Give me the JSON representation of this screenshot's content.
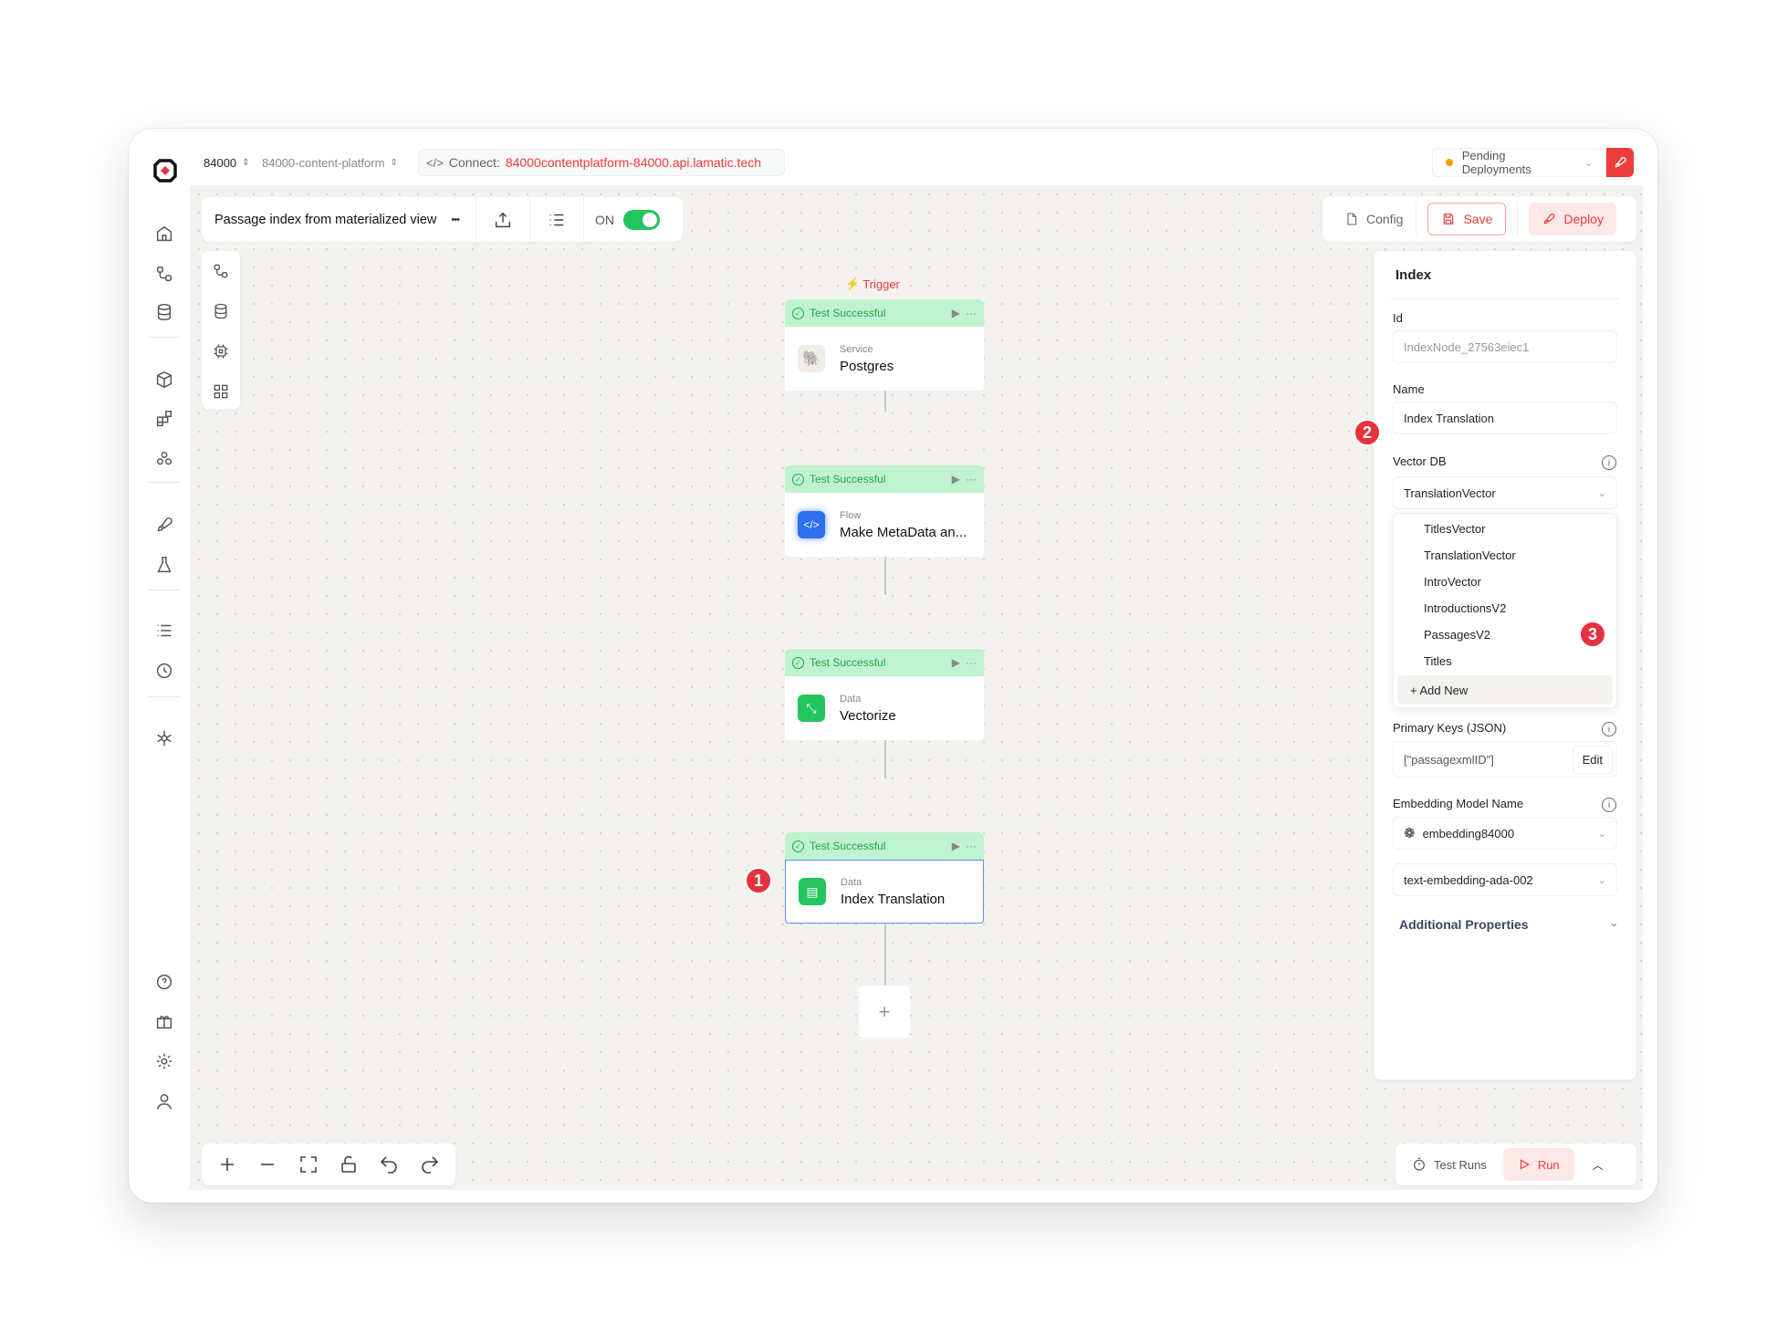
{
  "topbar": {
    "org": "84000",
    "project": "84000-content-platform",
    "connect_label": "Connect:",
    "connect_url": "84000contentplatform-84000.api.lamatic.tech",
    "pending": "Pending Deployments"
  },
  "toolbar": {
    "flow_name": "Passage index from materialized view",
    "more": "•••",
    "toggle_label": "ON",
    "toggle_on": true,
    "config": "Config",
    "save": "Save",
    "deploy": "Deploy"
  },
  "flow": {
    "trigger_label": "Trigger",
    "nodes": [
      {
        "status": "Test Successful",
        "category": "Service",
        "name": "Postgres",
        "icon": "postgres-icon"
      },
      {
        "status": "Test Successful",
        "category": "Flow",
        "name": "Make MetaData an...",
        "icon": "code-icon"
      },
      {
        "status": "Test Successful",
        "category": "Data",
        "name": "Vectorize",
        "icon": "vectorize-icon"
      },
      {
        "status": "Test Successful",
        "category": "Data",
        "name": "Index Translation",
        "icon": "index-icon"
      }
    ],
    "add": "+"
  },
  "annotations": [
    "1",
    "2",
    "3"
  ],
  "panel": {
    "title": "Index",
    "id_label": "Id",
    "id_value": "IndexNode_27563eiec1",
    "name_label": "Name",
    "name_value": "Index Translation",
    "vectordb_label": "Vector DB",
    "vectordb_value": "TranslationVector",
    "vectordb_options": [
      "TitlesVector",
      "TranslationVector",
      "IntroVector",
      "IntroductionsV2",
      "PassagesV2",
      "Titles"
    ],
    "add_new": "+ Add New",
    "pk_label": "Primary Keys (JSON)",
    "pk_value": "[\"passagexmlID\"]",
    "edit": "Edit",
    "emb_label": "Embedding Model Name",
    "emb_credential": "embedding84000",
    "emb_model": "text-embedding-ada-002",
    "additional": "Additional Properties"
  },
  "bottom": {
    "test_runs": "Test Runs",
    "run": "Run"
  },
  "colors": {
    "accent": "#ef3b3b",
    "success": "#22c55e",
    "success_bg": "#bff2cf",
    "canvas": "#f3f2ef"
  }
}
